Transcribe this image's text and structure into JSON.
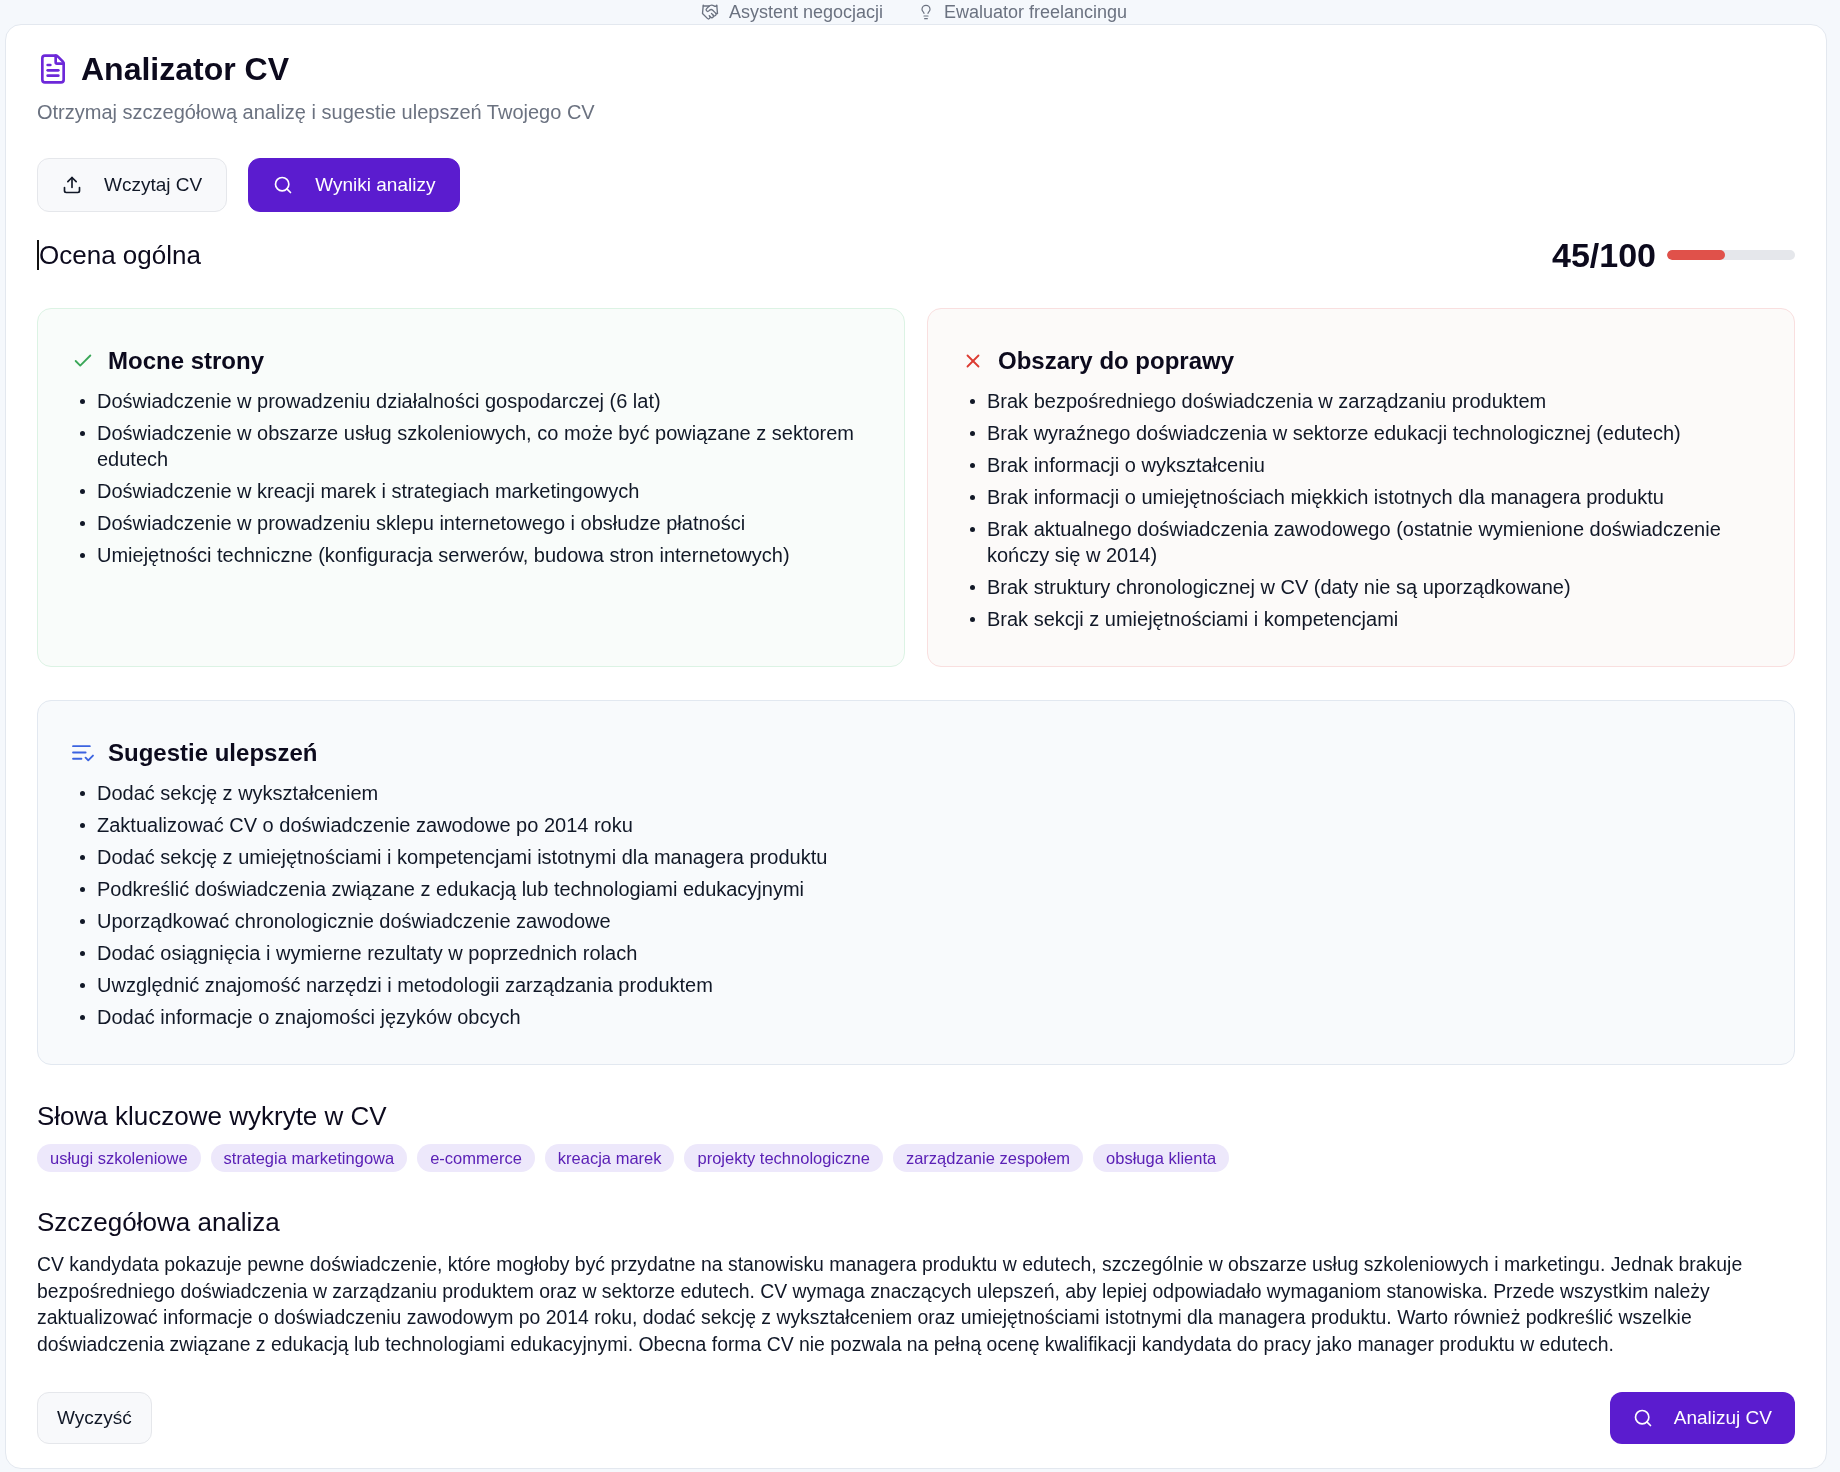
{
  "top_tabs": [
    {
      "label": "Asystent negocjacji",
      "kind": "handshake"
    },
    {
      "label": "Ewaluator freelancingu",
      "kind": "lightbulb"
    }
  ],
  "header": {
    "title": "Analizator CV",
    "subtitle": "Otrzymaj szczegółową analizę i sugestie ulepszeń Twojego CV"
  },
  "mode_buttons": [
    {
      "label": "Wczytaj CV",
      "kind": "upload",
      "selected": false
    },
    {
      "label": "Wyniki analizy",
      "kind": "search",
      "selected": true
    }
  ],
  "overall": {
    "label": "Ocena ogólna",
    "score": "45/100",
    "level": 0.45
  },
  "cards": [
    {
      "kind": "strengths",
      "title": "Mocne strony",
      "items": [
        "Doświadczenie w prowadzeniu działalności gospodarczej (6 lat)",
        "Doświadczenie w obszarze usług szkoleniowych, co może być powiązane z sektorem edutech",
        "Doświadczenie w kreacji marek i strategiach marketingowych",
        "Doświadczenie w prowadzeniu sklepu internetowego i obsłudze płatności",
        "Umiejętności techniczne (konfiguracja serwerów, budowa stron internetowych)"
      ]
    },
    {
      "kind": "improvements",
      "title": "Obszary do poprawy",
      "items": [
        "Brak bezpośredniego doświadczenia w zarządzaniu produktem",
        "Brak wyraźnego doświadczenia w sektorze edukacji technologicznej (edutech)",
        "Brak informacji o wykształceniu",
        "Brak informacji o umiejętnościach miękkich istotnych dla managera produktu",
        "Brak aktualnego doświadczenia zawodowego (ostatnie wymienione doświadczenie kończy się w 2014)",
        "Brak struktury chronologicznej w CV (daty nie są uporządkowane)",
        "Brak sekcji z umiejętnościami i kompetencjami"
      ]
    },
    {
      "kind": "suggestions",
      "title": "Sugestie ulepszeń",
      "items": [
        "Dodać sekcję z wykształceniem",
        "Zaktualizować CV o doświadczenie zawodowe po 2014 roku",
        "Dodać sekcję z umiejętnościami i kompetencjami istotnymi dla managera produktu",
        "Podkreślić doświadczenia związane z edukacją lub technologiami edukacyjnymi",
        "Uporządkować chronologicznie doświadczenie zawodowe",
        "Dodać osiągnięcia i wymierne rezultaty w poprzednich rolach",
        "Uwzględnić znajomość narzędzi i metodologii zarządzania produktem",
        "Dodać informacje o znajomości języków obcych"
      ]
    }
  ],
  "keywords": {
    "title": "Słowa kluczowe wykryte w CV",
    "tags": [
      "usługi szkoleniowe",
      "strategia marketingowa",
      "e-commerce",
      "kreacja marek",
      "projekty technologiczne",
      "zarządzanie zespołem",
      "obsługa klienta"
    ]
  },
  "analysis": {
    "title": "Szczegółowa analiza",
    "text": "CV kandydata pokazuje pewne doświadczenie, które mogłoby być przydatne na stanowisku managera produktu w edutech, szczególnie w obszarze usług szkoleniowych i marketingu. Jednak brakuje bezpośredniego doświadczenia w zarządzaniu produktem oraz w sektorze edutech. CV wymaga znaczących ulepszeń, aby lepiej odpowiadało wymaganiom stanowiska. Przede wszystkim należy zaktualizować informacje o doświadczeniu zawodowym po 2014 roku, dodać sekcję z wykształceniem oraz umiejętnościami istotnymi dla managera produktu. Warto również podkreślić wszelkie doświadczenia związane z edukacją lub technologiami edukacyjnymi. Obecna forma CV nie pozwala na pełną ocenę kwalifikacji kandydata do pracy jako manager produktu w edutech."
  },
  "actions": [
    {
      "label": "Wyczyść",
      "kind": "secondary"
    },
    {
      "label": "Analizuj CV",
      "kind": "primary"
    }
  ]
}
